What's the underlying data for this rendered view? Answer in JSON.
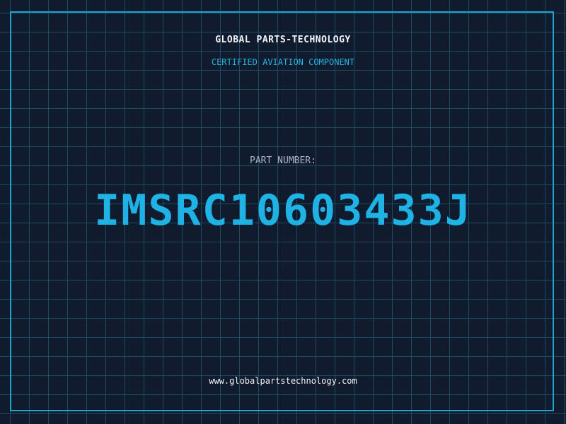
{
  "header": {
    "brand": "GLOBAL PARTS-TECHNOLOGY",
    "subtitle": "CERTIFIED AVIATION COMPONENT"
  },
  "part": {
    "label": "PART NUMBER:",
    "number": "IMSRC10603433J"
  },
  "footer": {
    "website": "www.globalpartstechnology.com"
  },
  "colors": {
    "background": "#111b2e",
    "grid": "#1d4a63",
    "accent": "#1fb2e4",
    "text": "#f2f4f7",
    "muted": "#a8b4c4"
  }
}
